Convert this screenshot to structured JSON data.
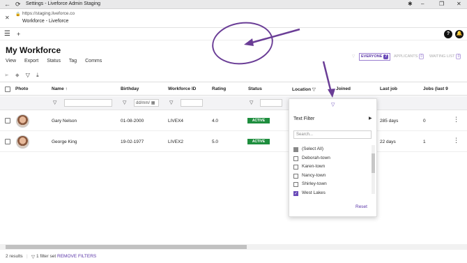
{
  "window": {
    "title": "Settings - Liveforce Admin Staging",
    "controls": {
      "extensions": "✱",
      "minimize": "–",
      "restore": "❐",
      "close": "✕"
    }
  },
  "address": {
    "url": "https://staging.liveforce.co",
    "page_title": "Workforce - Liveforce"
  },
  "app": {
    "help": "?",
    "notifications": "●"
  },
  "page": {
    "title": "My Workforce",
    "menu": [
      "View",
      "Export",
      "Status",
      "Tag",
      "Comms"
    ],
    "tabs": [
      {
        "label": "EVERYONE",
        "count": "7",
        "active": true
      },
      {
        "label": "APPLICANTS",
        "count": "0",
        "active": false
      },
      {
        "label": "WAITING LIST",
        "count": "0",
        "active": false
      }
    ]
  },
  "table": {
    "columns": [
      "Photo",
      "Name",
      "Birthday",
      "Workforce ID",
      "Rating",
      "Status",
      "Location",
      "Joined",
      "Last job",
      "Jobs (last 9"
    ],
    "birthday_placeholder": "dd/mm/",
    "rows": [
      {
        "name": "Gary Nelson",
        "birthday": "01-08-2000",
        "id": "LIVEX4",
        "rating": "4.0",
        "status": "ACTIVE",
        "last_job": "285 days",
        "jobs": "0"
      },
      {
        "name": "George King",
        "birthday": "19-02-1977",
        "id": "LIVEX2",
        "rating": "5.0",
        "status": "ACTIVE",
        "last_job": "22 days",
        "jobs": "1"
      }
    ]
  },
  "filter_popup": {
    "type_label": "Text Filter",
    "search_placeholder": "Search...",
    "options": [
      {
        "label": "(Select All)",
        "state": "indeterminate"
      },
      {
        "label": "Deborah-town",
        "state": "unchecked"
      },
      {
        "label": "Karen-town",
        "state": "unchecked"
      },
      {
        "label": "Nancy-town",
        "state": "unchecked"
      },
      {
        "label": "Shirley-town",
        "state": "unchecked"
      },
      {
        "label": "West Lakes",
        "state": "checked"
      }
    ],
    "reset_label": "Reset"
  },
  "footer": {
    "results": "2 results",
    "filter_set": "1 filter set",
    "remove": "REMOVE FILTERS"
  },
  "colors": {
    "accent": "#6a4bb8",
    "active_status": "#1e8e3e",
    "annotation": "#6a3d96"
  }
}
